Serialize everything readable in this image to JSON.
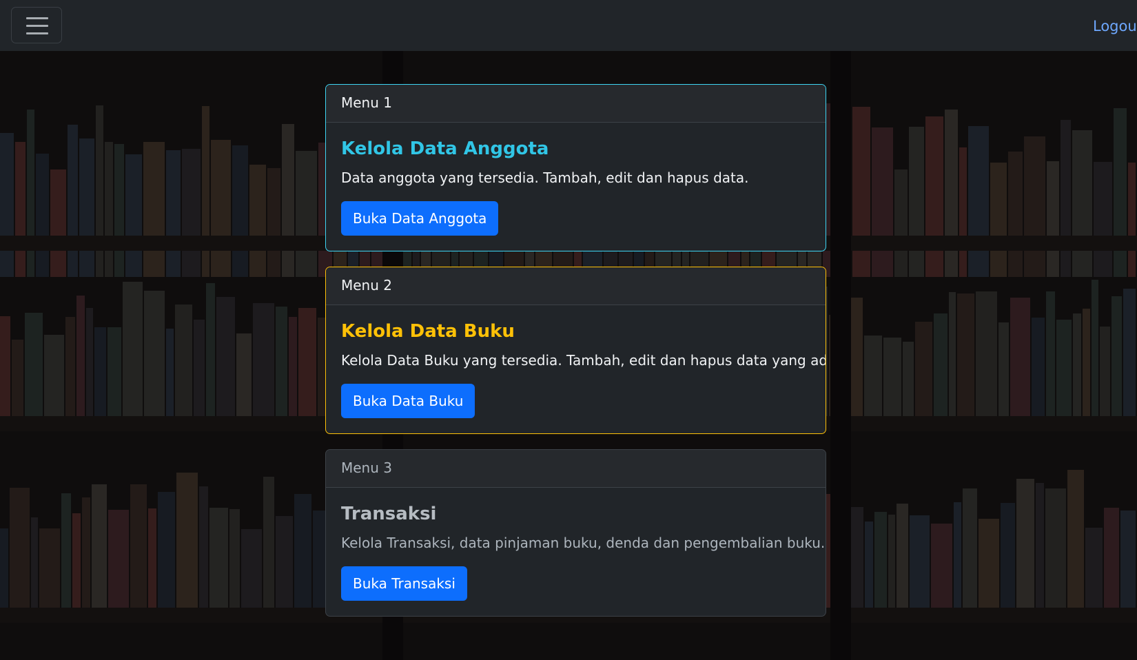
{
  "navbar": {
    "menu_icon": "hamburger-menu-icon",
    "logout_label": "Logout"
  },
  "cards": [
    {
      "header": "Menu 1",
      "title": "Kelola Data Anggota",
      "text": "Data anggota yang tersedia. Tambah, edit dan hapus data.",
      "button": "Buka Data Anggota",
      "accent": "#31c6e6"
    },
    {
      "header": "Menu 2",
      "title": "Kelola Data Buku",
      "text": "Kelola Data Buku yang tersedia. Tambah, edit dan hapus data yang ada.",
      "button": "Buka Data Buku",
      "accent": "#ffc107"
    },
    {
      "header": "Menu 3",
      "title": "Transaksi",
      "text": "Kelola Transaksi, data pinjaman buku, denda dan pengembalian buku.",
      "button": "Buka Transaksi",
      "accent": "#b6bcc2"
    }
  ],
  "colors": {
    "navbar_bg": "#212529",
    "card_bg": "#212529",
    "primary_button": "#0d6efd",
    "link": "#6ea8fe"
  }
}
